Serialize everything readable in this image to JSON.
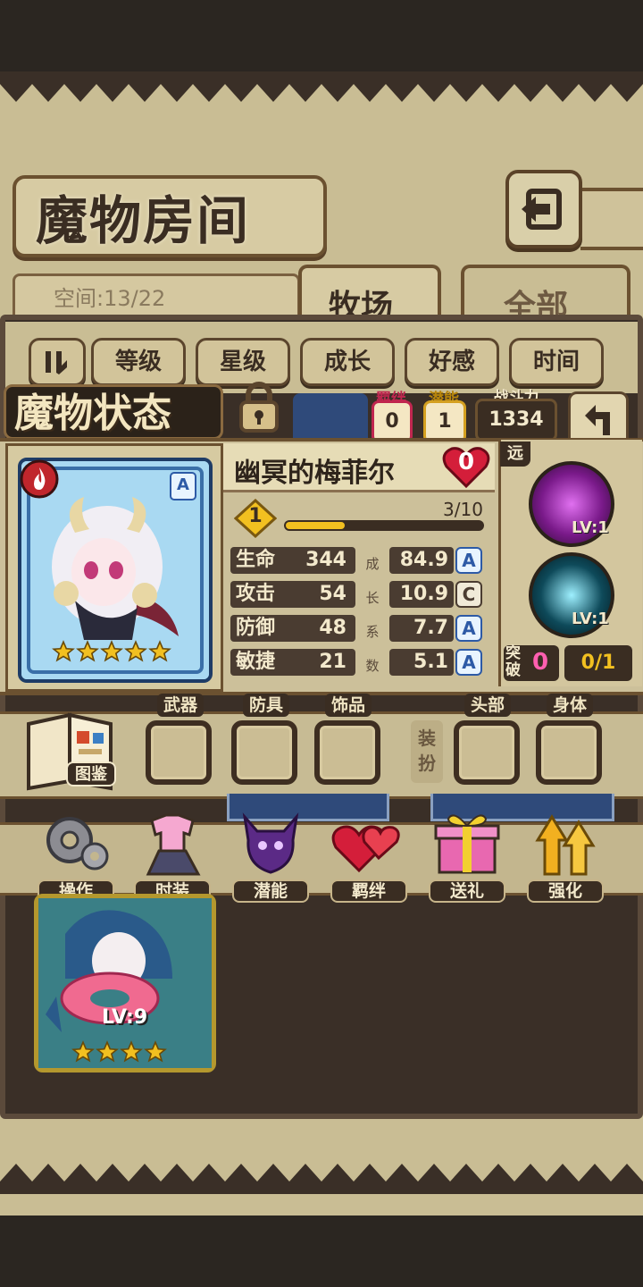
{
  "header": {
    "title": "魔物房间",
    "back_icon": "back-arrow-icon"
  },
  "space": {
    "label": "空间:13/22"
  },
  "tabs": [
    {
      "label": "牧场",
      "active": true
    },
    {
      "label": "全部",
      "active": false
    }
  ],
  "filters": [
    {
      "label": "等级"
    },
    {
      "label": "星级"
    },
    {
      "label": "成长"
    },
    {
      "label": "好感"
    },
    {
      "label": "时间"
    }
  ],
  "status": {
    "title": "魔物状态",
    "bond_label": "羁绊",
    "bond_value": "0",
    "potential_label": "潜能",
    "potential_value": "1",
    "power_label": "战斗力",
    "power_value": "1334"
  },
  "monster": {
    "name": "幽冥的梅菲尔",
    "affection": "0",
    "rank": "A",
    "level": "1",
    "exp": "3/10",
    "exp_fraction": 0.3,
    "stars": 5,
    "stats": [
      {
        "label": "生命",
        "value": "344",
        "growth": "84.9",
        "grade": "A"
      },
      {
        "label": "攻击",
        "value": "54",
        "growth": "10.9",
        "grade": "C"
      },
      {
        "label": "防御",
        "value": "48",
        "growth": "7.7",
        "grade": "A"
      },
      {
        "label": "敏捷",
        "value": "21",
        "growth": "5.1",
        "grade": "A"
      }
    ],
    "growth_chars": [
      "成",
      "长",
      "系",
      "数"
    ]
  },
  "skills": {
    "range_label": "远",
    "items": [
      {
        "level": "LV:1",
        "color": "#7a1a8a"
      },
      {
        "level": "LV:1",
        "color": "#0e4a5a"
      }
    ],
    "breakthrough_label": "突破",
    "breakthrough_value": "0",
    "breakthrough_progress": "0/1"
  },
  "equipment": {
    "codex_label": "图鉴",
    "dress_label": "装扮",
    "slots": [
      {
        "label": "武器"
      },
      {
        "label": "防具"
      },
      {
        "label": "饰品"
      },
      {
        "label": "头部"
      },
      {
        "label": "身体"
      }
    ]
  },
  "actions": [
    {
      "label": "操作",
      "icon": "gear-icon"
    },
    {
      "label": "时装",
      "icon": "outfit-icon"
    },
    {
      "label": "潜能",
      "icon": "demon-icon"
    },
    {
      "label": "羁绊",
      "icon": "hearts-icon"
    },
    {
      "label": "送礼",
      "icon": "gift-icon"
    },
    {
      "label": "强化",
      "icon": "upgrade-arrows-icon"
    }
  ],
  "monster_card": {
    "level": "LV:9",
    "stars": 4
  }
}
